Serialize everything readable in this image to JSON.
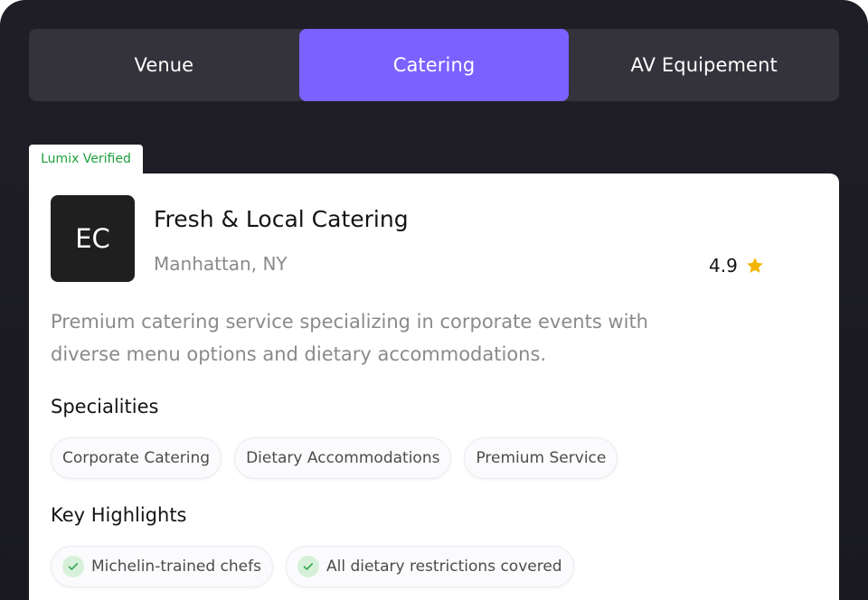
{
  "tabs": [
    {
      "label": "Venue",
      "active": false
    },
    {
      "label": "Catering",
      "active": true
    },
    {
      "label": "AV Equipement",
      "active": false
    }
  ],
  "badge": {
    "label": "Lumix Verified"
  },
  "vendor": {
    "initials": "EC",
    "name": "Fresh & Local Catering",
    "location": "Manhattan, NY",
    "rating": "4.9",
    "rating_icon": "star-icon",
    "description": "Premium catering service specializing in corporate events with diverse menu options and dietary accommodations."
  },
  "specialities": {
    "title": "Specialities",
    "items": [
      "Corporate Catering",
      "Dietary Accommodations",
      "Premium Service"
    ]
  },
  "highlights": {
    "title": "Key Highlights",
    "items": [
      "Michelin-trained chefs",
      "All dietary restrictions covered"
    ]
  },
  "colors": {
    "accent": "#7b61ff",
    "verified": "#1fa13a",
    "star": "#f5b400",
    "check_bg": "#d7f0d9",
    "check": "#34a853"
  }
}
